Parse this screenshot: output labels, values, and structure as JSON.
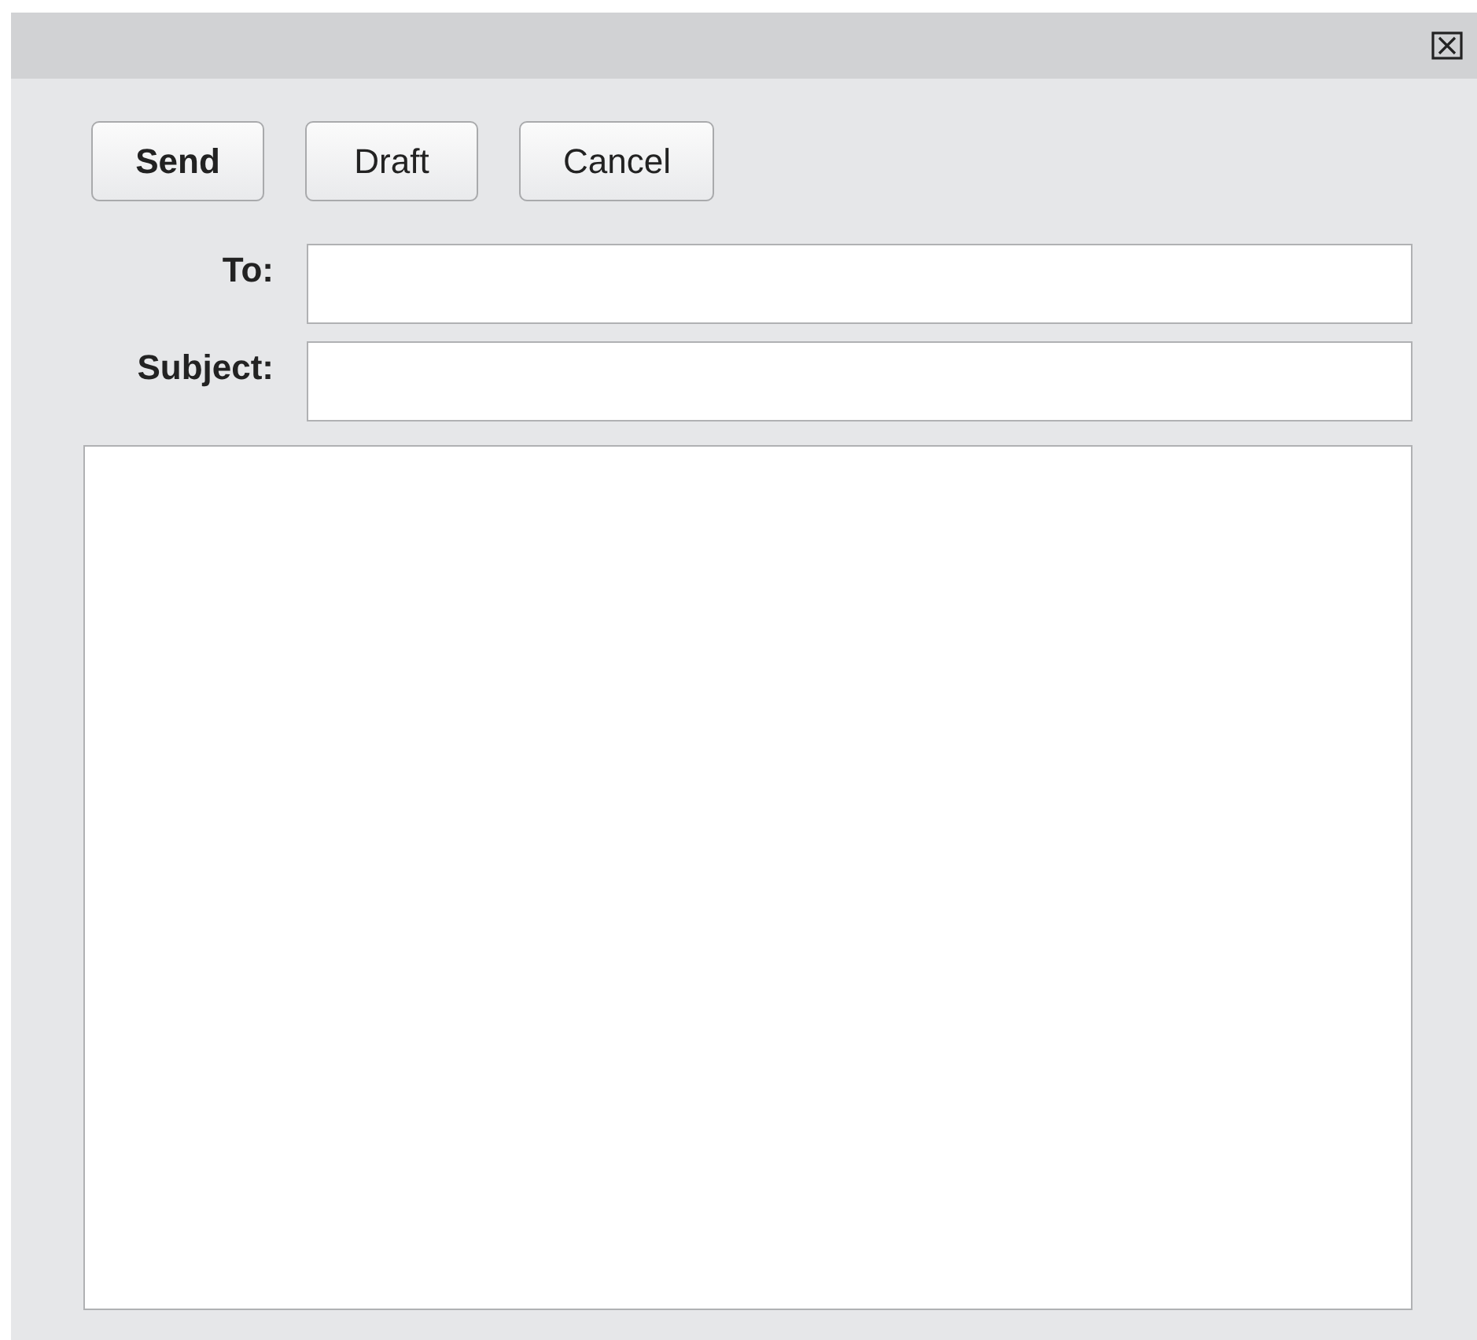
{
  "buttons": [
    {
      "label": "Send",
      "default": true
    },
    {
      "label": "Draft",
      "default": false
    },
    {
      "label": "Cancel",
      "default": false
    }
  ],
  "fields": [
    {
      "label": "To:"
    },
    {
      "label": "Subject:"
    }
  ]
}
